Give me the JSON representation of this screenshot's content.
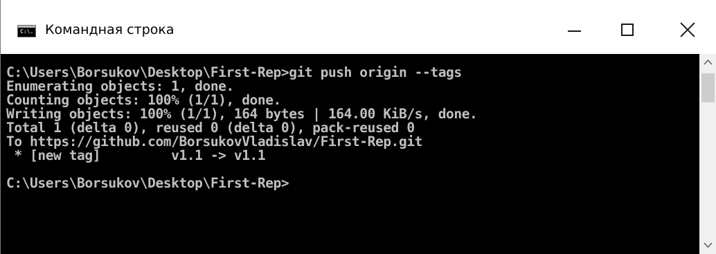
{
  "window": {
    "title": "Командная строка",
    "icon": "cmd-console-icon",
    "icon_text": "C:\\."
  },
  "controls": {
    "minimize": "minimize-icon",
    "maximize": "maximize-icon",
    "close": "close-icon"
  },
  "console": {
    "lines": [
      "C:\\Users\\Borsukov\\Desktop\\First-Rep>git push origin --tags",
      "Enumerating objects: 1, done.",
      "Counting objects: 100% (1/1), done.",
      "Writing objects: 100% (1/1), 164 bytes | 164.00 KiB/s, done.",
      "Total 1 (delta 0), reused 0 (delta 0), pack-reused 0",
      "To https://github.com/BorsukovVladislav/First-Rep.git",
      " * [new tag]         v1.1 -> v1.1",
      "",
      "C:\\Users\\Borsukov\\Desktop\\First-Rep>"
    ]
  },
  "colors": {
    "console_background": "#000000",
    "console_text": "#c0c0c0",
    "titlebar_background": "#ffffff"
  }
}
